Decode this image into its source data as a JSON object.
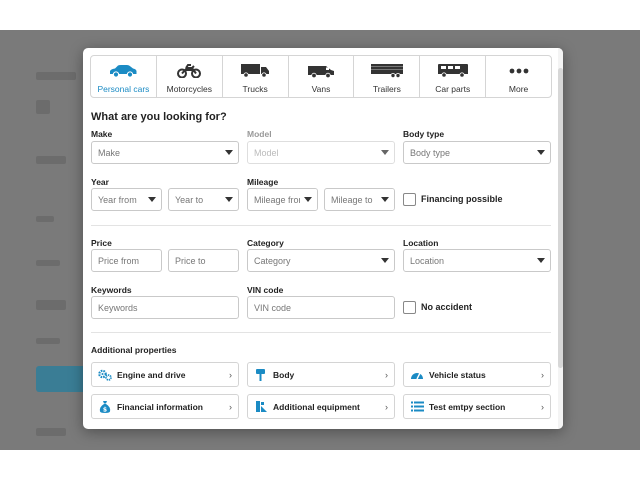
{
  "tabs": [
    {
      "label": "Personal cars",
      "icon": "car-icon",
      "active": true
    },
    {
      "label": "Motorcycles",
      "icon": "motorcycle-icon",
      "active": false
    },
    {
      "label": "Trucks",
      "icon": "truck-icon",
      "active": false
    },
    {
      "label": "Vans",
      "icon": "van-icon",
      "active": false
    },
    {
      "label": "Trailers",
      "icon": "trailer-icon",
      "active": false
    },
    {
      "label": "Car parts",
      "icon": "car-parts-icon",
      "active": false
    },
    {
      "label": "More",
      "icon": "more-dots-icon",
      "active": false
    }
  ],
  "form": {
    "heading": "What are you looking for?",
    "make": {
      "label": "Make",
      "placeholder": "Make"
    },
    "model": {
      "label": "Model",
      "placeholder": "Model"
    },
    "body_type": {
      "label": "Body type",
      "placeholder": "Body type"
    },
    "year": {
      "label": "Year",
      "from": "Year from",
      "to": "Year to"
    },
    "mileage": {
      "label": "Mileage",
      "from": "Mileage from",
      "to": "Mileage to"
    },
    "financing": {
      "label": "Financing possible",
      "checked": false
    },
    "price": {
      "label": "Price",
      "from": "Price from",
      "to": "Price to"
    },
    "category": {
      "label": "Category",
      "placeholder": "Category"
    },
    "location": {
      "label": "Location",
      "placeholder": "Location"
    },
    "keywords": {
      "label": "Keywords",
      "placeholder": "Keywords"
    },
    "vin": {
      "label": "VIN code",
      "placeholder": "VIN code"
    },
    "no_accident": {
      "label": "No accident",
      "checked": false
    }
  },
  "additional": {
    "heading": "Additional properties",
    "items": [
      {
        "label": "Engine and drive",
        "icon": "gears-icon"
      },
      {
        "label": "Body",
        "icon": "paint-roller-icon"
      },
      {
        "label": "Vehicle status",
        "icon": "speedometer-icon"
      },
      {
        "label": "Financial information",
        "icon": "money-bag-icon"
      },
      {
        "label": "Additional equipment",
        "icon": "equipment-icon"
      },
      {
        "label": "Test emtpy section",
        "icon": "list-icon"
      }
    ]
  },
  "colors": {
    "accent": "#1b8bc4",
    "backdrop": "#7a7a7a",
    "icon": "#1b8bc4"
  }
}
